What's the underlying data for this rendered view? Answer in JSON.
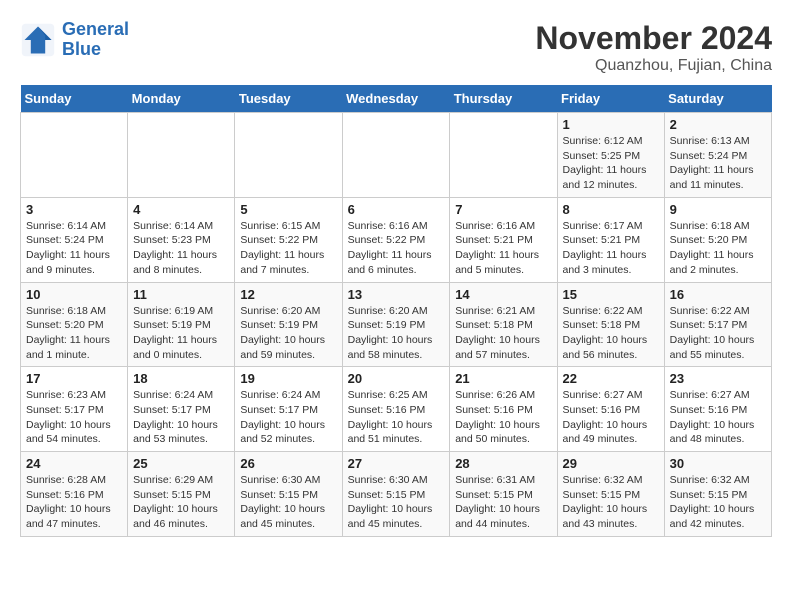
{
  "logo": {
    "line1": "General",
    "line2": "Blue"
  },
  "title": "November 2024",
  "subtitle": "Quanzhou, Fujian, China",
  "weekdays": [
    "Sunday",
    "Monday",
    "Tuesday",
    "Wednesday",
    "Thursday",
    "Friday",
    "Saturday"
  ],
  "weeks": [
    [
      {
        "day": "",
        "info": ""
      },
      {
        "day": "",
        "info": ""
      },
      {
        "day": "",
        "info": ""
      },
      {
        "day": "",
        "info": ""
      },
      {
        "day": "",
        "info": ""
      },
      {
        "day": "1",
        "info": "Sunrise: 6:12 AM\nSunset: 5:25 PM\nDaylight: 11 hours and 12 minutes."
      },
      {
        "day": "2",
        "info": "Sunrise: 6:13 AM\nSunset: 5:24 PM\nDaylight: 11 hours and 11 minutes."
      }
    ],
    [
      {
        "day": "3",
        "info": "Sunrise: 6:14 AM\nSunset: 5:24 PM\nDaylight: 11 hours and 9 minutes."
      },
      {
        "day": "4",
        "info": "Sunrise: 6:14 AM\nSunset: 5:23 PM\nDaylight: 11 hours and 8 minutes."
      },
      {
        "day": "5",
        "info": "Sunrise: 6:15 AM\nSunset: 5:22 PM\nDaylight: 11 hours and 7 minutes."
      },
      {
        "day": "6",
        "info": "Sunrise: 6:16 AM\nSunset: 5:22 PM\nDaylight: 11 hours and 6 minutes."
      },
      {
        "day": "7",
        "info": "Sunrise: 6:16 AM\nSunset: 5:21 PM\nDaylight: 11 hours and 5 minutes."
      },
      {
        "day": "8",
        "info": "Sunrise: 6:17 AM\nSunset: 5:21 PM\nDaylight: 11 hours and 3 minutes."
      },
      {
        "day": "9",
        "info": "Sunrise: 6:18 AM\nSunset: 5:20 PM\nDaylight: 11 hours and 2 minutes."
      }
    ],
    [
      {
        "day": "10",
        "info": "Sunrise: 6:18 AM\nSunset: 5:20 PM\nDaylight: 11 hours and 1 minute."
      },
      {
        "day": "11",
        "info": "Sunrise: 6:19 AM\nSunset: 5:19 PM\nDaylight: 11 hours and 0 minutes."
      },
      {
        "day": "12",
        "info": "Sunrise: 6:20 AM\nSunset: 5:19 PM\nDaylight: 10 hours and 59 minutes."
      },
      {
        "day": "13",
        "info": "Sunrise: 6:20 AM\nSunset: 5:19 PM\nDaylight: 10 hours and 58 minutes."
      },
      {
        "day": "14",
        "info": "Sunrise: 6:21 AM\nSunset: 5:18 PM\nDaylight: 10 hours and 57 minutes."
      },
      {
        "day": "15",
        "info": "Sunrise: 6:22 AM\nSunset: 5:18 PM\nDaylight: 10 hours and 56 minutes."
      },
      {
        "day": "16",
        "info": "Sunrise: 6:22 AM\nSunset: 5:17 PM\nDaylight: 10 hours and 55 minutes."
      }
    ],
    [
      {
        "day": "17",
        "info": "Sunrise: 6:23 AM\nSunset: 5:17 PM\nDaylight: 10 hours and 54 minutes."
      },
      {
        "day": "18",
        "info": "Sunrise: 6:24 AM\nSunset: 5:17 PM\nDaylight: 10 hours and 53 minutes."
      },
      {
        "day": "19",
        "info": "Sunrise: 6:24 AM\nSunset: 5:17 PM\nDaylight: 10 hours and 52 minutes."
      },
      {
        "day": "20",
        "info": "Sunrise: 6:25 AM\nSunset: 5:16 PM\nDaylight: 10 hours and 51 minutes."
      },
      {
        "day": "21",
        "info": "Sunrise: 6:26 AM\nSunset: 5:16 PM\nDaylight: 10 hours and 50 minutes."
      },
      {
        "day": "22",
        "info": "Sunrise: 6:27 AM\nSunset: 5:16 PM\nDaylight: 10 hours and 49 minutes."
      },
      {
        "day": "23",
        "info": "Sunrise: 6:27 AM\nSunset: 5:16 PM\nDaylight: 10 hours and 48 minutes."
      }
    ],
    [
      {
        "day": "24",
        "info": "Sunrise: 6:28 AM\nSunset: 5:16 PM\nDaylight: 10 hours and 47 minutes."
      },
      {
        "day": "25",
        "info": "Sunrise: 6:29 AM\nSunset: 5:15 PM\nDaylight: 10 hours and 46 minutes."
      },
      {
        "day": "26",
        "info": "Sunrise: 6:30 AM\nSunset: 5:15 PM\nDaylight: 10 hours and 45 minutes."
      },
      {
        "day": "27",
        "info": "Sunrise: 6:30 AM\nSunset: 5:15 PM\nDaylight: 10 hours and 45 minutes."
      },
      {
        "day": "28",
        "info": "Sunrise: 6:31 AM\nSunset: 5:15 PM\nDaylight: 10 hours and 44 minutes."
      },
      {
        "day": "29",
        "info": "Sunrise: 6:32 AM\nSunset: 5:15 PM\nDaylight: 10 hours and 43 minutes."
      },
      {
        "day": "30",
        "info": "Sunrise: 6:32 AM\nSunset: 5:15 PM\nDaylight: 10 hours and 42 minutes."
      }
    ]
  ]
}
